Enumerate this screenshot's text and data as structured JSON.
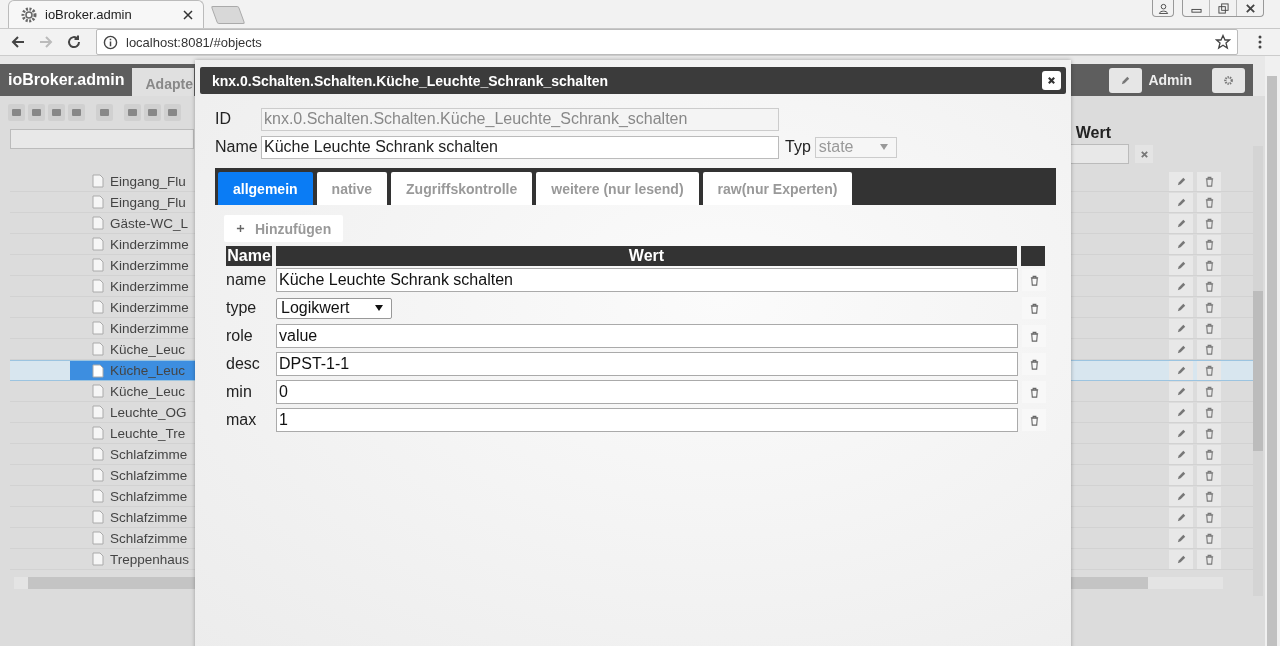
{
  "browser": {
    "tab_title": "ioBroker.admin",
    "url": "localhost:8081/#objects"
  },
  "app": {
    "brand": "ioBroker.admin",
    "tab": "Adapte",
    "user": "Admin",
    "value_header": "Wert",
    "objects": [
      {
        "name": "Eingang_Flu",
        "selected": false
      },
      {
        "name": "Eingang_Flu",
        "selected": false
      },
      {
        "name": "Gäste-WC_L",
        "selected": false
      },
      {
        "name": "Kinderzimme",
        "selected": false
      },
      {
        "name": "Kinderzimme",
        "selected": false
      },
      {
        "name": "Kinderzimme",
        "selected": false
      },
      {
        "name": "Kinderzimme",
        "selected": false
      },
      {
        "name": "Kinderzimme",
        "selected": false
      },
      {
        "name": "Küche_Leuc",
        "selected": false
      },
      {
        "name": "Küche_Leuc",
        "selected": true
      },
      {
        "name": "Küche_Leuc",
        "selected": false
      },
      {
        "name": "Leuchte_OG",
        "selected": false
      },
      {
        "name": "Leuchte_Tre",
        "selected": false
      },
      {
        "name": "Schlafzimme",
        "selected": false
      },
      {
        "name": "Schlafzimme",
        "selected": false
      },
      {
        "name": "Schlafzimme",
        "selected": false
      },
      {
        "name": "Schlafzimme",
        "selected": false
      },
      {
        "name": "Schlafzimme",
        "selected": false
      },
      {
        "name": "Treppenhaus",
        "selected": false
      }
    ]
  },
  "dialog": {
    "title": "knx.0.Schalten.Schalten.Küche_Leuchte_Schrank_schalten",
    "id_label": "ID",
    "id_value": "knx.0.Schalten.Schalten.Küche_Leuchte_Schrank_schalten",
    "name_label": "Name",
    "name_value": "Küche Leuchte Schrank schalten",
    "type_label": "Typ",
    "type_value": "state",
    "tabs": [
      {
        "label": "allgemein",
        "selected": true
      },
      {
        "label": "native",
        "selected": false
      },
      {
        "label": "Zugriffskontrolle",
        "selected": false
      },
      {
        "label": "weitere (nur lesend)",
        "selected": false
      },
      {
        "label": "raw(nur Experten)",
        "selected": false
      }
    ],
    "add_button": "Hinzufügen",
    "columns": [
      "Name",
      "Wert"
    ],
    "rows": [
      {
        "kind": "text",
        "key": "name",
        "value": "Küche Leuchte Schrank schalten"
      },
      {
        "kind": "select",
        "key": "type",
        "value": "Logikwert"
      },
      {
        "kind": "text",
        "key": "role",
        "value": "value"
      },
      {
        "kind": "text",
        "key": "desc",
        "value": "DPST-1-1"
      },
      {
        "kind": "text",
        "key": "min",
        "value": "0"
      },
      {
        "kind": "text",
        "key": "max",
        "value": "1"
      }
    ]
  }
}
